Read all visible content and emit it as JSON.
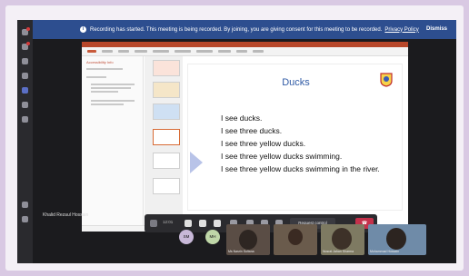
{
  "meeting": {
    "banner_text": "Recording has started. This meeting is being recorded. By joining, you are giving consent for this meeting to be recorded.",
    "privacy_link": "Privacy Policy",
    "dismiss_label": "Dismiss",
    "presenter_name": "Khalid Rezaul Hossain"
  },
  "powerpoint": {
    "comments_heading": "Accessibility Info",
    "slide": {
      "title": "Ducks",
      "lines": [
        "I see ducks.",
        "I see three ducks.",
        "I see three yellow ducks.",
        "I see three yellow ducks swimming.",
        "I see three yellow ducks swimming in the river."
      ]
    }
  },
  "call_controls": {
    "timer": "12:01",
    "request_control_label": "Request control",
    "hangup_icon": "phone-hangup-icon"
  },
  "participants": {
    "avatars": [
      {
        "initials": "SM",
        "color": "#c8b8d8"
      },
      {
        "initials": "MH",
        "color": "#bfd7a8"
      }
    ],
    "tiles": [
      {
        "name": "Ms Nasrin Sultana"
      },
      {
        "name": ""
      },
      {
        "name": "Nusrat Jahan Sharma"
      },
      {
        "name": "Mohammad Hossain"
      }
    ]
  },
  "colors": {
    "banner": "#2d4e8f",
    "powerpoint_brand": "#b7472a",
    "slide_title": "#2f5aa5",
    "hangup": "#c4314b",
    "page_background": "#d9c9e3"
  }
}
